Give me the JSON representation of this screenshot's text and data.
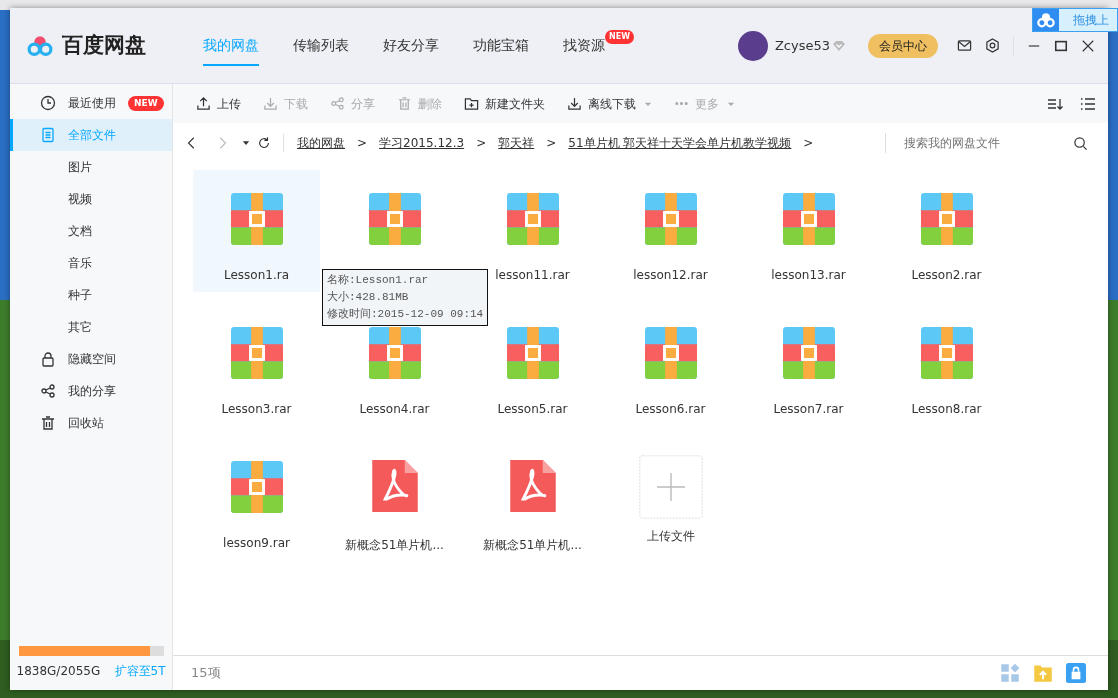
{
  "app": {
    "name": "百度网盘"
  },
  "nav_tabs": [
    {
      "label": "我的网盘",
      "selected": true
    },
    {
      "label": "传输列表",
      "selected": false
    },
    {
      "label": "好友分享",
      "selected": false
    },
    {
      "label": "功能宝箱",
      "selected": false
    },
    {
      "label": "找资源",
      "selected": false,
      "badge": "NEW"
    }
  ],
  "user": {
    "name": "Zcyse53",
    "vip_button": "会员中心"
  },
  "drag_upload": {
    "label": "拖拽上"
  },
  "sidebar": {
    "items": [
      {
        "label": "最近使用",
        "kind": "clock",
        "selected": false,
        "badge": "NEW"
      },
      {
        "label": "全部文件",
        "kind": "doc",
        "selected": true
      },
      {
        "label": "图片",
        "kind": "sub",
        "selected": false
      },
      {
        "label": "视频",
        "kind": "sub",
        "selected": false
      },
      {
        "label": "文档",
        "kind": "sub",
        "selected": false
      },
      {
        "label": "音乐",
        "kind": "sub",
        "selected": false
      },
      {
        "label": "种子",
        "kind": "sub",
        "selected": false
      },
      {
        "label": "其它",
        "kind": "sub",
        "selected": false
      },
      {
        "label": "隐藏空间",
        "kind": "lock",
        "selected": false
      },
      {
        "label": "我的分享",
        "kind": "share",
        "selected": false
      },
      {
        "label": "回收站",
        "kind": "trash",
        "selected": false
      }
    ],
    "storage": {
      "level": 0.9,
      "usage": "1838G/2055G",
      "expand_link": "扩容至5T"
    }
  },
  "toolbar": [
    {
      "label": "上传",
      "kind": "upload",
      "disabled": false
    },
    {
      "label": "下载",
      "kind": "download",
      "disabled": true
    },
    {
      "label": "分享",
      "kind": "share",
      "disabled": true
    },
    {
      "label": "删除",
      "kind": "trash",
      "disabled": true
    },
    {
      "label": "新建文件夹",
      "kind": "folder",
      "disabled": false
    },
    {
      "label": "离线下载",
      "kind": "download",
      "disabled": false,
      "dropdown": true
    },
    {
      "label": "更多",
      "kind": "more",
      "disabled": true,
      "dropdown": true
    }
  ],
  "breadcrumb": [
    {
      "label": "我的网盘",
      "separator": ">"
    },
    {
      "label": "学习2015.12.3",
      "separator": ">"
    },
    {
      "label": "郭天祥",
      "separator": ">"
    },
    {
      "label": "51单片机 郭天祥十天学会单片机教学视频",
      "separator": ">"
    }
  ],
  "search": {
    "placeholder": "搜索我的网盘文件"
  },
  "files": [
    {
      "name": "Lesson1.ra",
      "kind": "rar",
      "selected": true
    },
    {
      "kind": "rar",
      "selected": false
    },
    {
      "name": "lesson11.rar",
      "kind": "rar",
      "selected": false
    },
    {
      "name": "lesson12.rar",
      "kind": "rar",
      "selected": false
    },
    {
      "name": "lesson13.rar",
      "kind": "rar",
      "selected": false
    },
    {
      "name": "Lesson2.rar",
      "kind": "rar",
      "selected": false
    },
    {
      "name": "Lesson3.rar",
      "kind": "rar",
      "selected": false
    },
    {
      "name": "Lesson4.rar",
      "kind": "rar",
      "selected": false
    },
    {
      "name": "Lesson5.rar",
      "kind": "rar",
      "selected": false
    },
    {
      "name": "Lesson6.rar",
      "kind": "rar",
      "selected": false
    },
    {
      "name": "Lesson7.rar",
      "kind": "rar",
      "selected": false
    },
    {
      "name": "Lesson8.rar",
      "kind": "rar",
      "selected": false
    },
    {
      "name": "lesson9.rar",
      "kind": "rar",
      "selected": false
    },
    {
      "name": "新概念51单片机...",
      "kind": "pdf",
      "selected": false
    },
    {
      "name": "新概念51单片机...",
      "kind": "pdf",
      "selected": false
    },
    {
      "name": "上传文件",
      "kind": "upload",
      "selected": false
    }
  ],
  "tooltip": [
    "名称:Lesson1.rar",
    "大小:428.81MB",
    "修改时间:2015-12-09 09:14"
  ],
  "status_bar": {
    "count": "15项"
  }
}
